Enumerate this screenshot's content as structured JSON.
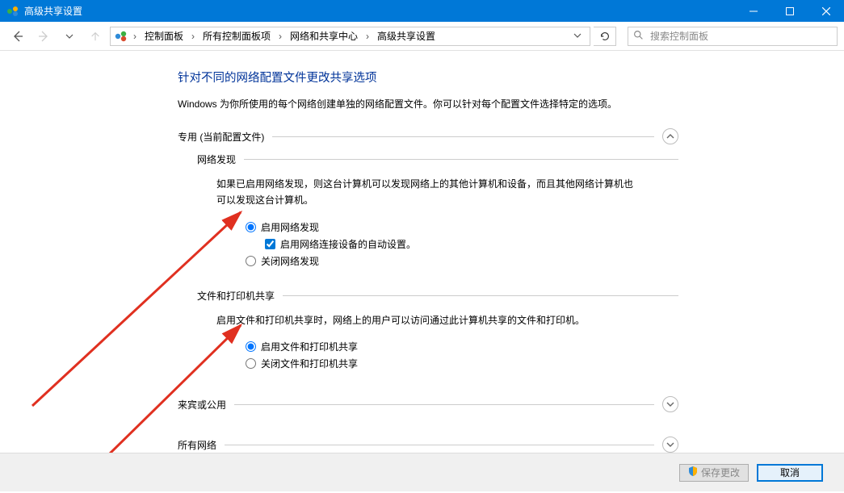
{
  "window": {
    "title": "高级共享设置"
  },
  "breadcrumbs": {
    "b1": "控制面板",
    "b2": "所有控制面板项",
    "b3": "网络和共享中心",
    "b4": "高级共享设置"
  },
  "search": {
    "placeholder": "搜索控制面板"
  },
  "page": {
    "title": "针对不同的网络配置文件更改共享选项",
    "sub": "Windows 为你所使用的每个网络创建单独的网络配置文件。你可以针对每个配置文件选择特定的选项。"
  },
  "sections": {
    "private": {
      "label": "专用 (当前配置文件)",
      "network_discovery": {
        "header": "网络发现",
        "desc": "如果已启用网络发现，则这台计算机可以发现网络上的其他计算机和设备，而且其他网络计算机也可以发现这台计算机。",
        "opt_on": "启用网络发现",
        "opt_on_sub": "启用网络连接设备的自动设置。",
        "opt_off": "关闭网络发现"
      },
      "file_printer": {
        "header": "文件和打印机共享",
        "desc": "启用文件和打印机共享时，网络上的用户可以访问通过此计算机共享的文件和打印机。",
        "opt_on": "启用文件和打印机共享",
        "opt_off": "关闭文件和打印机共享"
      }
    },
    "guest": {
      "label": "来宾或公用"
    },
    "all": {
      "label": "所有网络"
    }
  },
  "footer": {
    "save": "保存更改",
    "cancel": "取消"
  }
}
